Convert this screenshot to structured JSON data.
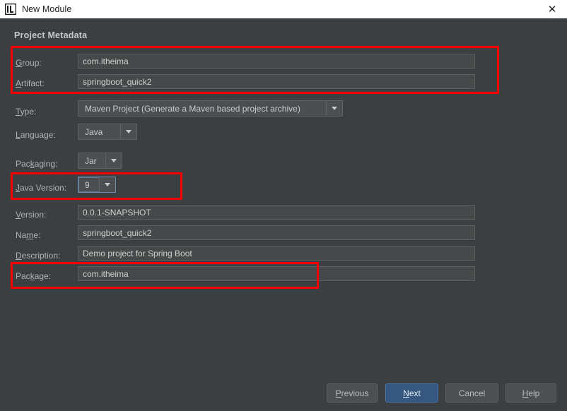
{
  "window": {
    "title": "New Module",
    "app_icon": "intellij-idea-icon",
    "close_icon": "close-icon"
  },
  "dialog": {
    "section_title": "Project Metadata",
    "fields": [
      {
        "key": "group",
        "label": "Group:",
        "mnemonic": "G",
        "value": "com.itheima",
        "control": "text"
      },
      {
        "key": "artifact",
        "label": "Artifact:",
        "mnemonic": "A",
        "value": "springboot_quick2",
        "control": "text"
      },
      {
        "key": "type",
        "label": "Type:",
        "mnemonic": "T",
        "value": "Maven Project (Generate a Maven based project archive)",
        "control": "combo"
      },
      {
        "key": "language",
        "label": "Language:",
        "mnemonic": "L",
        "value": "Java",
        "control": "combo"
      },
      {
        "key": "packaging",
        "label": "Packaging:",
        "mnemonic": "",
        "value": "Jar",
        "control": "combo"
      },
      {
        "key": "javaversion",
        "label": "Java Version:",
        "mnemonic": "J",
        "value": "9",
        "control": "combo"
      },
      {
        "key": "version",
        "label": "Version:",
        "mnemonic": "V",
        "value": "0.0.1-SNAPSHOT",
        "control": "text"
      },
      {
        "key": "name",
        "label": "Name:",
        "mnemonic": "m",
        "value": "springboot_quick2",
        "control": "text"
      },
      {
        "key": "description",
        "label": "Description:",
        "mnemonic": "D",
        "value": "Demo project for Spring Boot",
        "control": "text"
      },
      {
        "key": "package",
        "label": "Package:",
        "mnemonic": "k",
        "value": "com.itheima",
        "control": "text"
      }
    ]
  },
  "annotations": {
    "color": "#f50000",
    "boxes": [
      {
        "name": "group-artifact-highlight",
        "label": "Group and Artifact"
      },
      {
        "name": "java-version-highlight",
        "label": "Java Version"
      },
      {
        "name": "package-highlight",
        "label": "Package"
      }
    ]
  },
  "buttons": [
    {
      "key": "previous",
      "label": "Previous",
      "mnemonic": "P",
      "default": false
    },
    {
      "key": "next",
      "label": "Next",
      "mnemonic": "N",
      "default": true
    },
    {
      "key": "cancel",
      "label": "Cancel",
      "mnemonic": "",
      "default": false
    },
    {
      "key": "help",
      "label": "Help",
      "mnemonic": "H",
      "default": false
    }
  ],
  "colors": {
    "dialog_background": "#3c3f41",
    "field_background": "#45494a",
    "titlebar_background": "#ffffff",
    "accent_default_button": "#365880",
    "annotation_red": "#f50000",
    "focus_border": "#6e8aa8"
  }
}
